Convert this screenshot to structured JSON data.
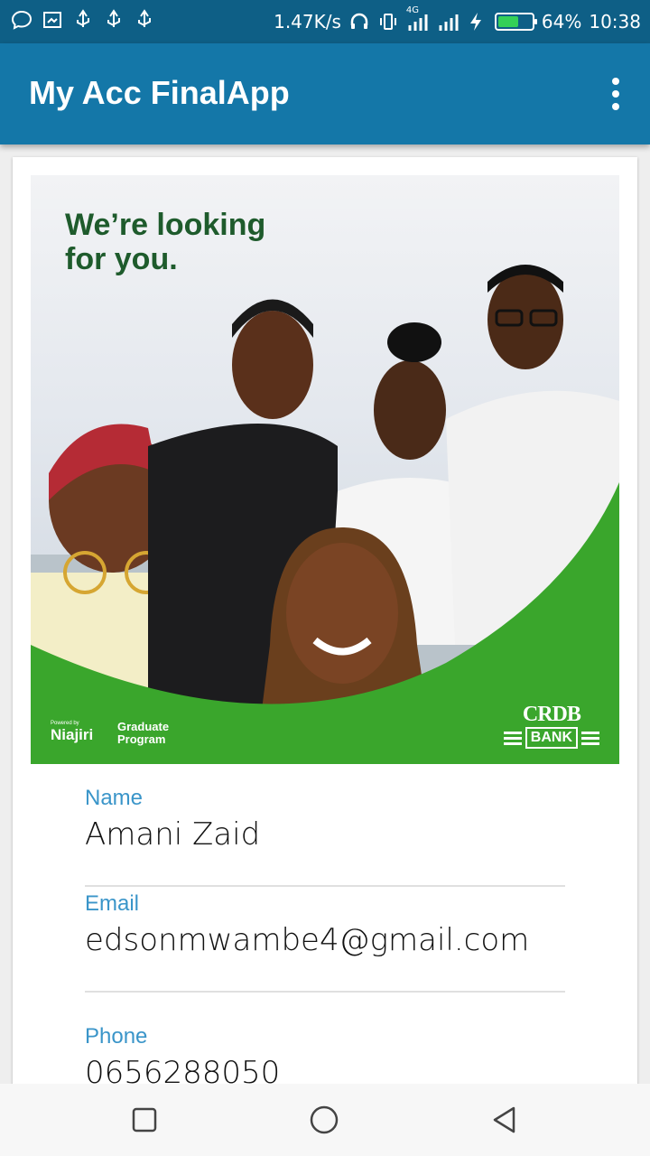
{
  "status_bar": {
    "speed": "1.47K/s",
    "network": "4G",
    "battery_percent": "64%",
    "battery_level": 0.64,
    "time": "10:38",
    "battery_color": "#34d058"
  },
  "app_bar": {
    "title": "My Acc FinalApp",
    "color": "#1477a8"
  },
  "banner": {
    "headline_line1": "We’re looking",
    "headline_line2": "for you.",
    "powered_by": "Powered by",
    "niajiri": "Niajiri",
    "graduate_line1": "Graduate",
    "graduate_line2": "Program",
    "bank_logo": "CRDB",
    "bank_word": "BANK"
  },
  "profile": {
    "name_label": "Name",
    "name_value": "Amani Zaid",
    "email_label": "Email",
    "email_value": "edsonmwambe4@gmail.com",
    "phone_label": "Phone",
    "phone_value": "0656288050"
  },
  "colors": {
    "label": "#3a95c9",
    "brand_green": "#3aa62c"
  }
}
